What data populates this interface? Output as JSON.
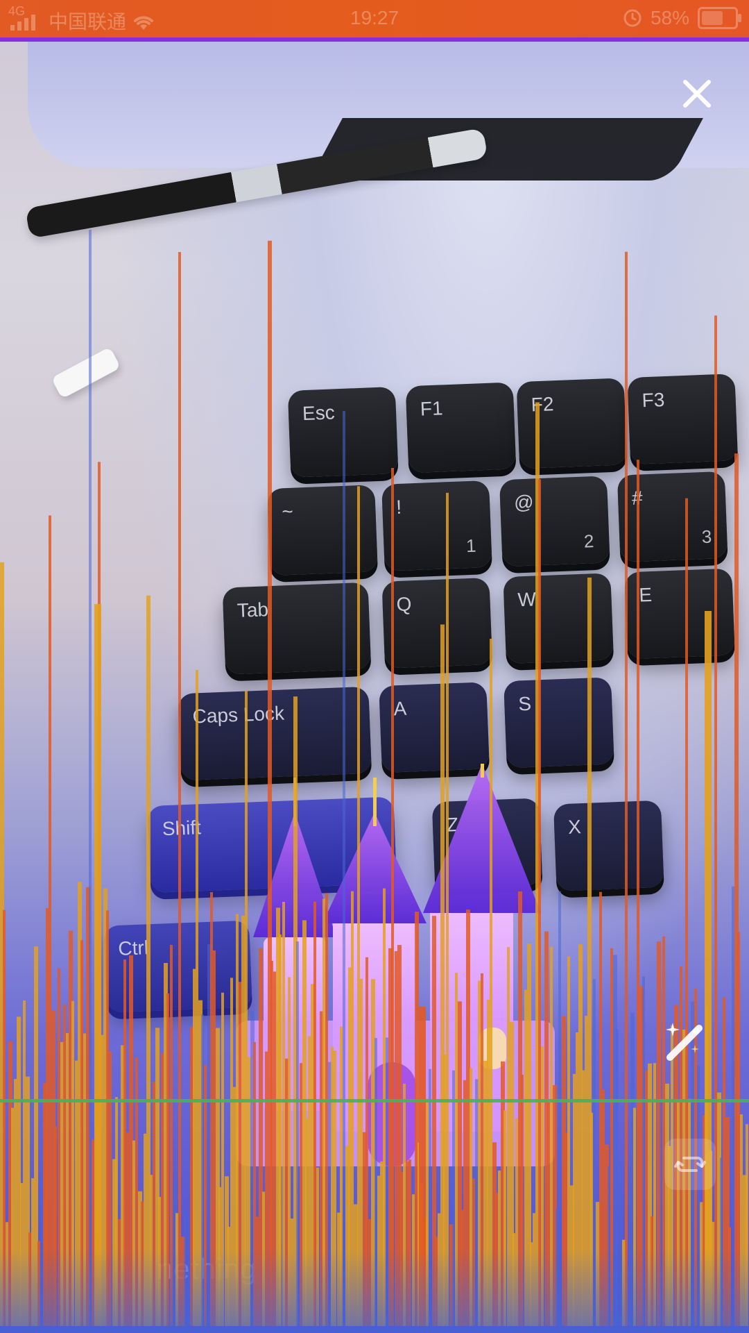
{
  "status_bar": {
    "network_type": "4G",
    "carrier": "中国联通",
    "time": "19:27",
    "battery_percent": "58%",
    "icons": {
      "signal": "signal-icon",
      "wifi": "wifi-icon",
      "clock": "clock-icon",
      "battery": "battery-icon"
    }
  },
  "camera": {
    "keyboard_keys": [
      {
        "name": "key-esc",
        "label": "Esc"
      },
      {
        "name": "key-f1",
        "label": "F1"
      },
      {
        "name": "key-f2",
        "label": "F2"
      },
      {
        "name": "key-f3",
        "label": "F3"
      },
      {
        "name": "key-tilde",
        "label": "~"
      },
      {
        "name": "key-1",
        "label": "!",
        "sub": "1"
      },
      {
        "name": "key-2",
        "label": "@",
        "sub": "2"
      },
      {
        "name": "key-3",
        "label": "#",
        "sub": "3"
      },
      {
        "name": "key-tab",
        "label": "Tab"
      },
      {
        "name": "key-q",
        "label": "Q"
      },
      {
        "name": "key-w",
        "label": "W"
      },
      {
        "name": "key-e",
        "label": "E"
      },
      {
        "name": "key-caps",
        "label": "Caps Lock"
      },
      {
        "name": "key-a",
        "label": "A"
      },
      {
        "name": "key-s",
        "label": "S"
      },
      {
        "name": "key-shift",
        "label": "Shift"
      },
      {
        "name": "key-z",
        "label": "Z"
      },
      {
        "name": "key-x",
        "label": "X"
      },
      {
        "name": "key-ctrl",
        "label": "Ctrl"
      }
    ]
  },
  "controls": {
    "close_icon": "close-icon",
    "magic_icon": "magic-wand-icon",
    "flip_icon": "camera-flip-icon"
  },
  "sticker": {
    "name": "castle-sticker",
    "caption": "nething"
  },
  "colors": {
    "status_bg": "#E45C1D",
    "status_border": "#8A2BE2",
    "overlay_orange": "#E3A11F",
    "overlay_red": "#E25A24",
    "overlay_blue": "#4A66D6",
    "line_green": "#46B35A",
    "castle_purple": "#7A3DD9",
    "castle_pink": "#E7A4F2"
  }
}
